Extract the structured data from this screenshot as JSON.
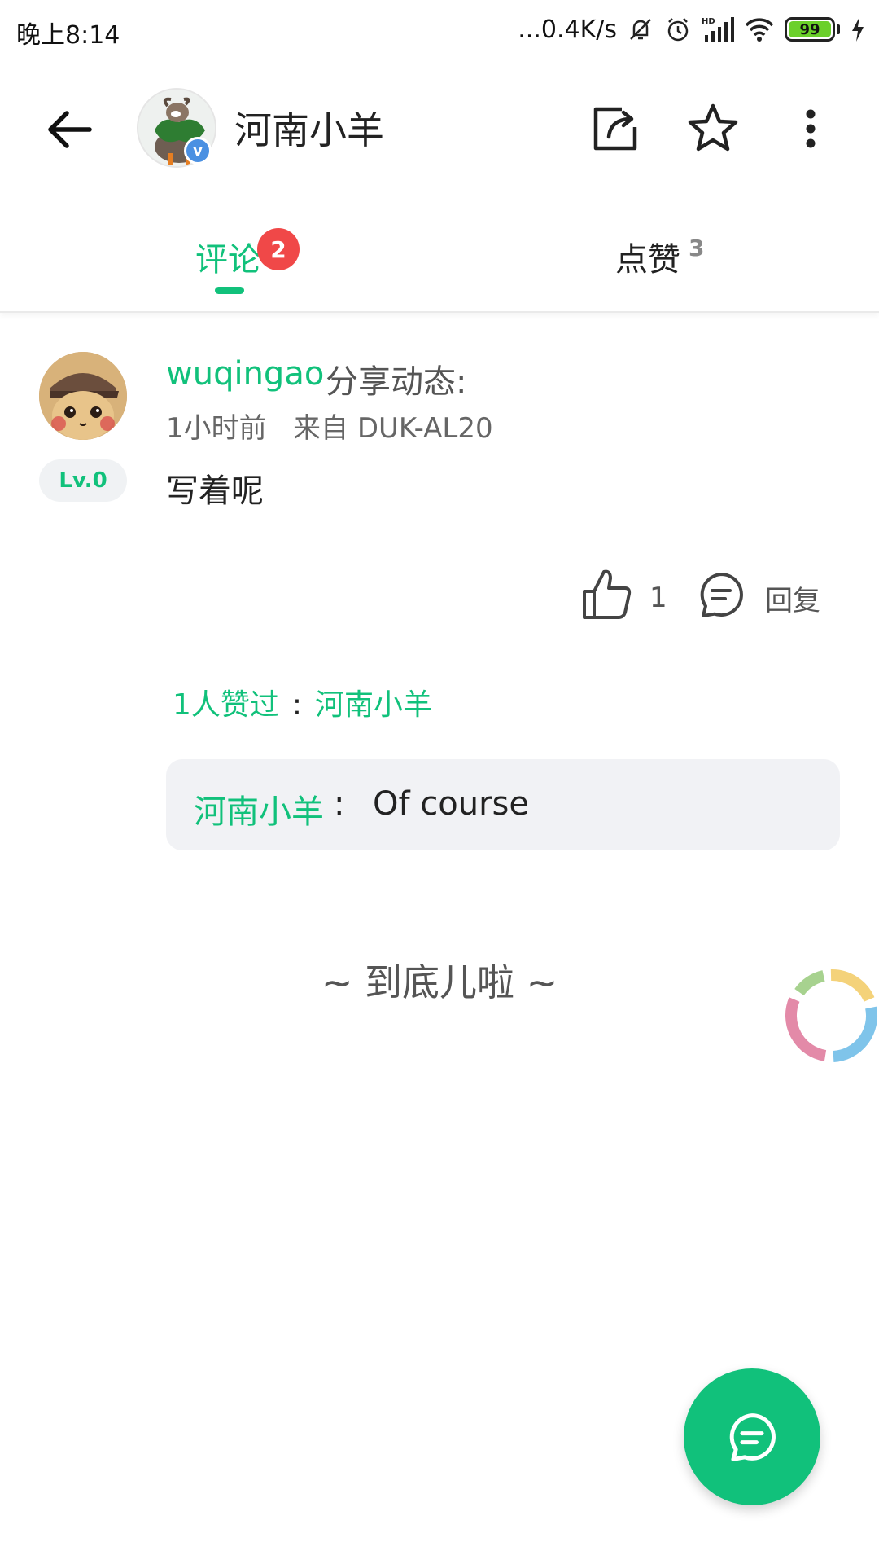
{
  "status_bar": {
    "time": "晚上8:14",
    "net_speed": "...0.4K/s",
    "battery": "99",
    "icons": [
      "mute-bell-icon",
      "alarm-icon",
      "hd-signal-icon",
      "wifi-icon",
      "battery-icon",
      "charging-icon"
    ]
  },
  "toolbar": {
    "title": "河南小羊",
    "verified_mark": "v",
    "icons": [
      "back-arrow-icon",
      "share-icon",
      "star-icon",
      "more-vertical-icon"
    ]
  },
  "tabs": {
    "comments_label": "评论",
    "comments_badge": "2",
    "likes_label": "点赞",
    "likes_count": "3"
  },
  "comment": {
    "user": "wuqingao",
    "action": "分享动态:",
    "meta": "1小时前   来自 DUK-AL20",
    "level": "Lv.0",
    "text": "写着呢",
    "like_count": "1",
    "reply_label": "回复",
    "likers_prefix": "1人赞过",
    "likers_sep": ":",
    "likers_name": "河南小羊",
    "reply": {
      "user": "河南小羊",
      "sep": ":",
      "text": "Of course"
    }
  },
  "footer": {
    "end_text": "~ 到底儿啦 ~"
  },
  "colors": {
    "accent": "#11c17b",
    "badge": "#f04848"
  }
}
